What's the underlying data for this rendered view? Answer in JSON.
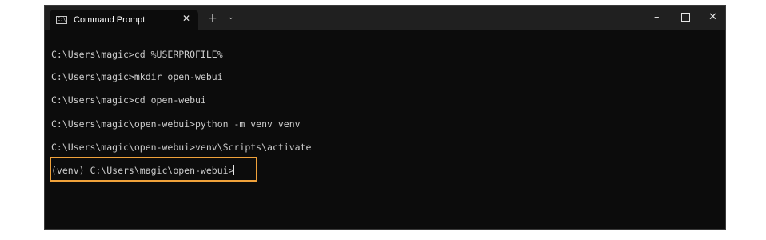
{
  "window": {
    "tab_title": "Command Prompt",
    "tab_icon_text": "C:\\",
    "tab_close": "✕",
    "new_tab": "+",
    "dropdown": "⌄",
    "minimize": "–",
    "close": "✕"
  },
  "terminal": {
    "lines": [
      "C:\\Users\\magic>cd %USERPROFILE%",
      "C:\\Users\\magic>mkdir open-webui",
      "C:\\Users\\magic>cd open-webui",
      "C:\\Users\\magic\\open-webui>python -m venv venv",
      "C:\\Users\\magic\\open-webui>venv\\Scripts\\activate",
      "(venv) C:\\Users\\magic\\open-webui>"
    ]
  },
  "colors": {
    "terminal_bg": "#0c0c0c",
    "titlebar_bg": "#202020",
    "text": "#cccccc",
    "highlight": "#f0a23b"
  }
}
